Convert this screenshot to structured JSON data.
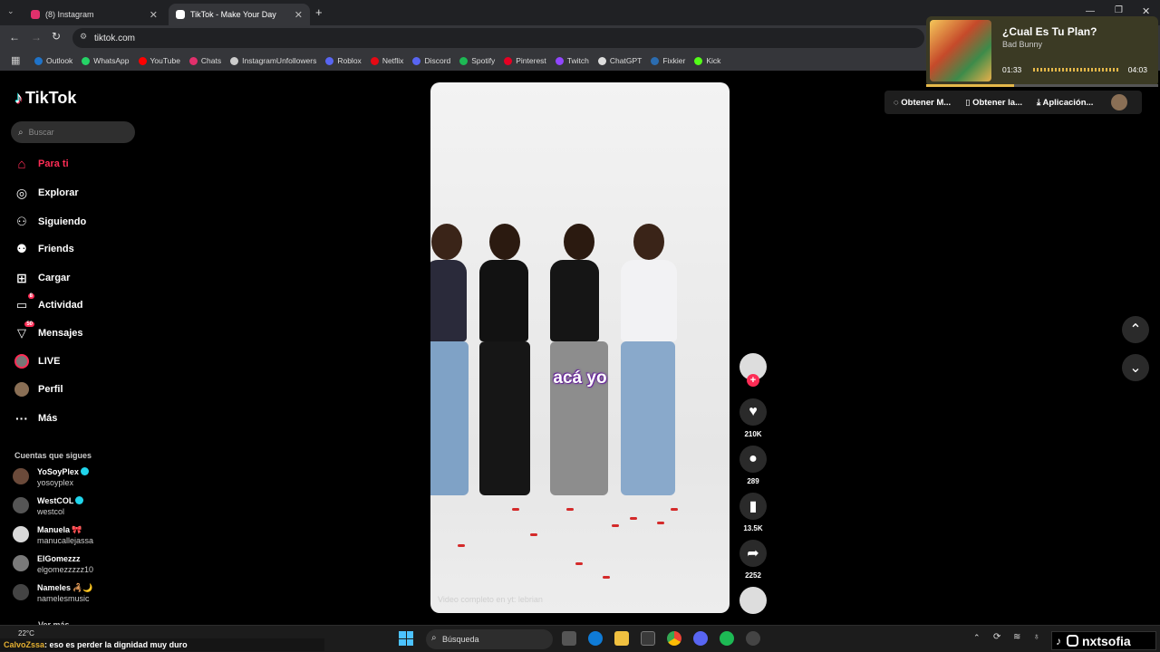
{
  "browser": {
    "tabs": [
      {
        "label": "(8) Instagram",
        "fav_color": "#e1306c"
      },
      {
        "label": "TikTok - Make Your Day",
        "fav_color": "#ffffff"
      }
    ],
    "url": "tiktok.com",
    "bookmarks": [
      {
        "label": "Outlook",
        "color": "#1f73c9"
      },
      {
        "label": "WhatsApp",
        "color": "#25d366"
      },
      {
        "label": "YouTube",
        "color": "#ff0000"
      },
      {
        "label": "Chats",
        "color": "#e1306c"
      },
      {
        "label": "InstagramUnfollowers",
        "color": "#cccccc"
      },
      {
        "label": "Roblox",
        "color": "#5865f2"
      },
      {
        "label": "Netflix",
        "color": "#e50914"
      },
      {
        "label": "Discord",
        "color": "#5865f2"
      },
      {
        "label": "Spotify",
        "color": "#1db954"
      },
      {
        "label": "Pinterest",
        "color": "#e60023"
      },
      {
        "label": "Twitch",
        "color": "#9146ff"
      },
      {
        "label": "ChatGPT",
        "color": "#dddddd"
      },
      {
        "label": "Fixkier",
        "color": "#2b6cb0"
      },
      {
        "label": "Kick",
        "color": "#53fc18"
      }
    ]
  },
  "media": {
    "title": "¿Cual Es Tu Plan?",
    "artist": "Bad Bunny",
    "elapsed": "01:33",
    "total": "04:03",
    "progress": 0.38
  },
  "tiktok": {
    "logo": "TikTok",
    "search_placeholder": "Buscar",
    "nav": [
      {
        "label": "Para ti",
        "active": true
      },
      {
        "label": "Explorar"
      },
      {
        "label": "Siguiendo"
      },
      {
        "label": "Friends"
      },
      {
        "label": "Cargar"
      },
      {
        "label": "Actividad",
        "badge": "8"
      },
      {
        "label": "Mensajes",
        "badge": "50"
      },
      {
        "label": "LIVE"
      },
      {
        "label": "Perfil"
      },
      {
        "label": "Más"
      }
    ],
    "following_title": "Cuentas que sigues",
    "accounts": [
      {
        "name": "YoSoyPlex",
        "user": "yosoyplex",
        "verified": true
      },
      {
        "name": "WestCOL",
        "user": "westcol",
        "verified": true
      },
      {
        "name": "Manuela",
        "user": "manucallejassa",
        "emoji": "🎀"
      },
      {
        "name": "ElGomezzz",
        "user": "elgomezzzzz10"
      },
      {
        "name": "Nameles",
        "user": "namelesmusic",
        "emoji": "🦂🌙"
      }
    ],
    "see_more": "Ver más",
    "top_buttons": [
      "Obtener M...",
      "Obtener la...",
      "Aplicación..."
    ],
    "video": {
      "caption": "acá yo",
      "note": "Video completo en yt: lebrian"
    },
    "actions": {
      "likes": "210K",
      "comments": "289",
      "saves": "13.5K",
      "shares": "2252"
    }
  },
  "taskbar": {
    "weather": "22°C",
    "search": "Búsqueda",
    "chat_user": "CalvoZssa",
    "chat_message": ": eso es perder la dignidad muy duro",
    "overlay_name": "nxtsofia"
  }
}
